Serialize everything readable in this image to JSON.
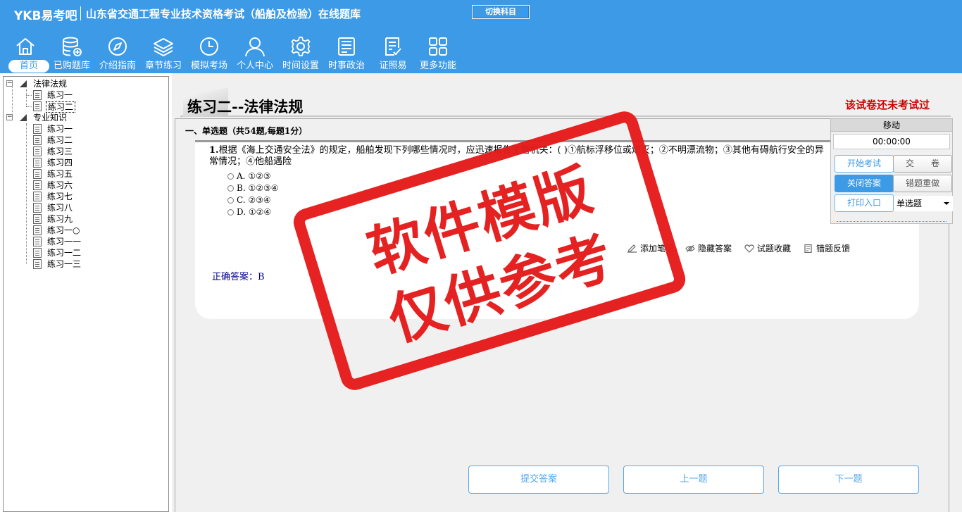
{
  "header": {
    "logo": "YKB易考吧",
    "app_title": "山东省交通工程专业技术资格考试（船舶及检验）在线题库",
    "switch_subject": "切换科目"
  },
  "nav": {
    "items": [
      {
        "label": "首页",
        "icon": "home-icon",
        "active": true
      },
      {
        "label": "已购题库",
        "icon": "database-icon"
      },
      {
        "label": "介绍指南",
        "icon": "compass-icon"
      },
      {
        "label": "章节练习",
        "icon": "layers-icon"
      },
      {
        "label": "模拟考场",
        "icon": "clock-icon"
      },
      {
        "label": "个人中心",
        "icon": "user-icon"
      },
      {
        "label": "时间设置",
        "icon": "gear-icon"
      },
      {
        "label": "时事政治",
        "icon": "newspaper-icon"
      },
      {
        "label": "证照易",
        "icon": "checklist-icon"
      },
      {
        "label": "更多功能",
        "icon": "grid-icon"
      }
    ]
  },
  "tree": {
    "nodes": [
      {
        "label": "法律法规",
        "level": 0,
        "expander": "−"
      },
      {
        "label": "练习一",
        "level": 1
      },
      {
        "label": "练习二",
        "level": 1,
        "selected": true
      },
      {
        "label": "专业知识",
        "level": 0,
        "expander": "−"
      },
      {
        "label": "练习一",
        "level": 1
      },
      {
        "label": "练习二",
        "level": 1
      },
      {
        "label": "练习三",
        "level": 1
      },
      {
        "label": "练习四",
        "level": 1
      },
      {
        "label": "练习五",
        "level": 1
      },
      {
        "label": "练习六",
        "level": 1
      },
      {
        "label": "练习七",
        "level": 1
      },
      {
        "label": "练习八",
        "level": 1
      },
      {
        "label": "练习九",
        "level": 1
      },
      {
        "label": "练习一○",
        "level": 1
      },
      {
        "label": "练习一一",
        "level": 1
      },
      {
        "label": "练习一二",
        "level": 1
      },
      {
        "label": "练习一三",
        "level": 1
      }
    ]
  },
  "content": {
    "title": "练习二--法律法规",
    "exam_status": "该试卷还未考试过",
    "section_header": "一、单选题（共54题,每题1分）",
    "question": {
      "number": "1.",
      "text": "根据《海上交通安全法》的规定，船舶发现下列哪些情况时，应迅速报告主管机关：( )①航标浮移位或熄灭；②不明漂流物；③其他有碍航行安全的异常情况；④他船遇险",
      "options": [
        {
          "letter": "A.",
          "text": "①②③"
        },
        {
          "letter": "B.",
          "text": "①②③④"
        },
        {
          "letter": "C.",
          "text": "②③④"
        },
        {
          "letter": "D.",
          "text": "①②④"
        }
      ]
    },
    "tools": [
      {
        "label": "添加笔记",
        "icon": "pencil-icon"
      },
      {
        "label": "隐藏答案",
        "icon": "eye-icon"
      },
      {
        "label": "试题收藏",
        "icon": "heart-icon"
      },
      {
        "label": "错题反馈",
        "icon": "feedback-icon"
      }
    ],
    "answer_label": "正确答案：",
    "answer_value": "B",
    "buttons": {
      "submit": "提交答案",
      "prev": "上一题",
      "next": "下一题"
    }
  },
  "panel": {
    "move": "移动",
    "timer": "00:00:00",
    "start_exam": "开始考试",
    "hand_in": "交　　卷",
    "close_answer": "关闭答案",
    "redo_wrong": "错题重做",
    "print": "打印入口",
    "type_select": "单选题"
  },
  "watermark": {
    "line1": "软件模版",
    "line2": "仅供参考"
  },
  "colors": {
    "header_bg": "#3d9ae6",
    "status_red": "#d10000",
    "stamp_red": "#e51b1b",
    "answer_blue": "#00008b"
  }
}
